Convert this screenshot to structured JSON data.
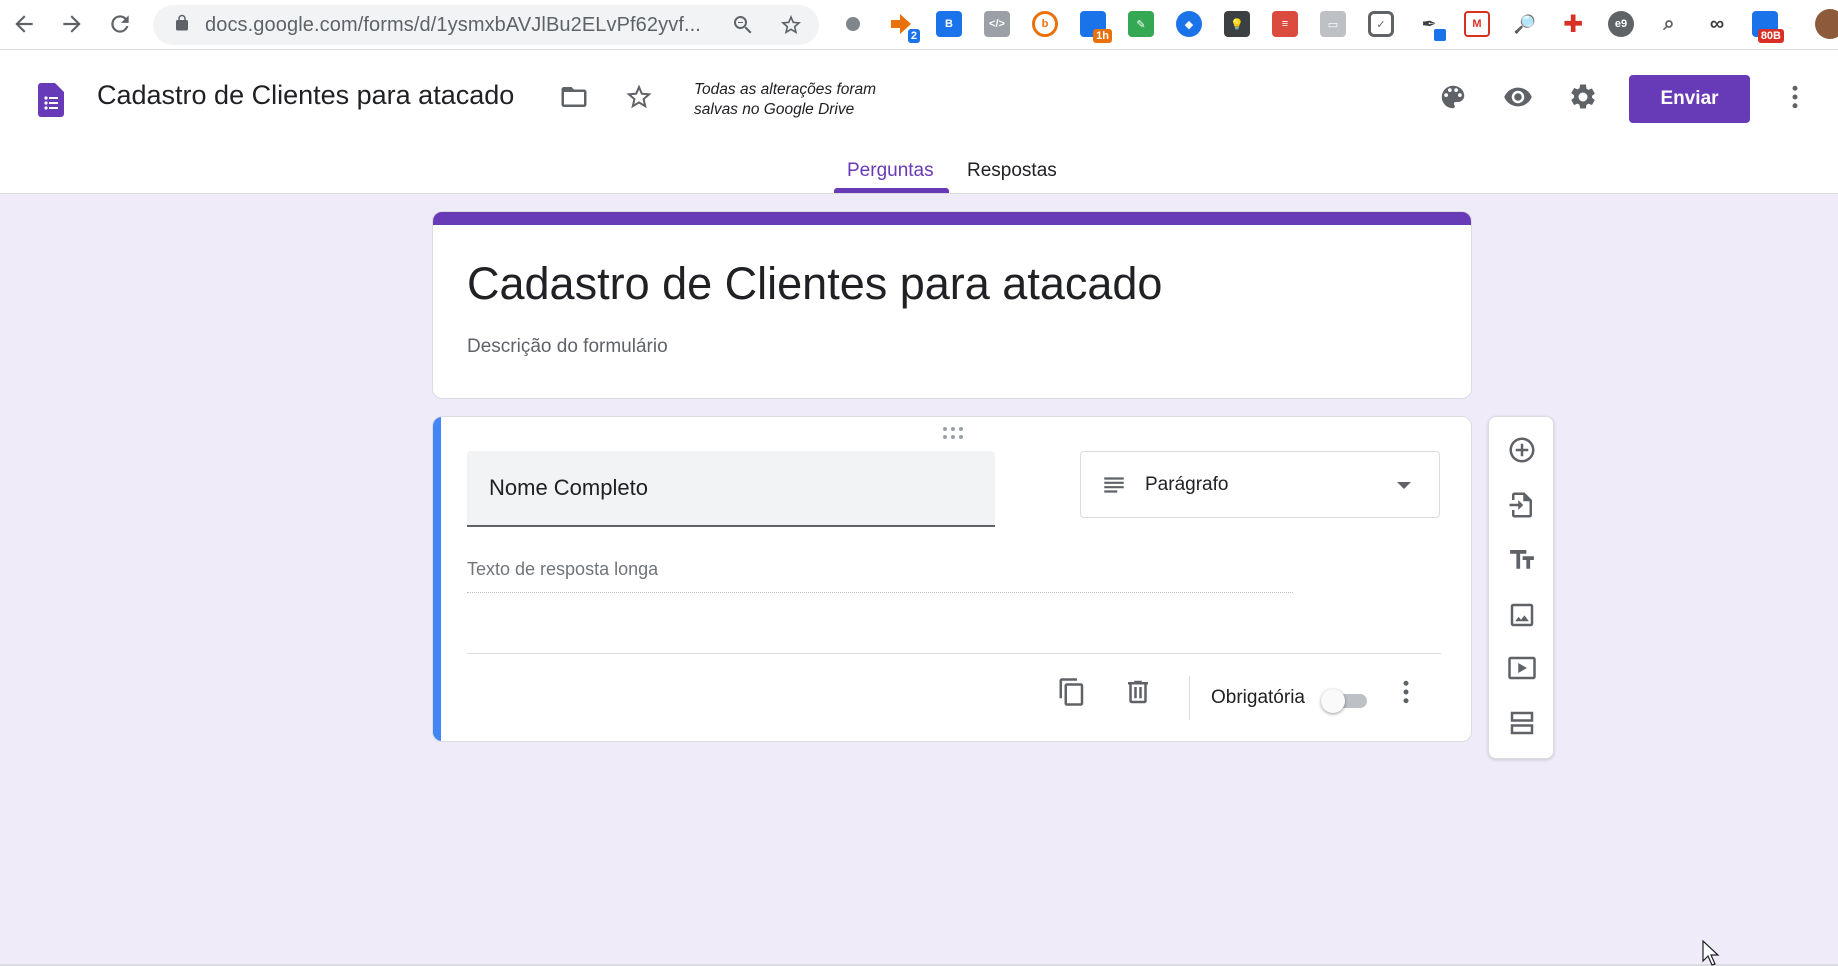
{
  "browser": {
    "url": "docs.google.com/forms/d/1ysmxbAVJlBu2ELvPf62yvf...",
    "extension_badges": {
      "ext_2": "2",
      "ext_1h": "1h",
      "ext_80b": "80B"
    }
  },
  "header": {
    "doc_title": "Cadastro de Clientes para atacado",
    "save_status_line1": "Todas as alterações foram",
    "save_status_line2": "salvas no Google Drive",
    "send_label": "Enviar",
    "tabs": [
      {
        "label": "Perguntas",
        "active": true
      },
      {
        "label": "Respostas",
        "active": false
      }
    ]
  },
  "form": {
    "title": "Cadastro de Clientes para atacado",
    "description_placeholder": "Descrição do formulário",
    "question": {
      "title": "Nome Completo",
      "type": "Parágrafo",
      "answer_placeholder": "Texto de resposta longa",
      "required_label": "Obrigatória",
      "required": false
    }
  },
  "colors": {
    "accent": "#673ab7",
    "background": "#f0ebf8",
    "active_question_bar": "#4285f4"
  },
  "icons": {
    "side_toolbar": [
      "add-question-icon",
      "import-questions-icon",
      "add-title-icon",
      "add-image-icon",
      "add-video-icon",
      "add-section-icon"
    ]
  }
}
